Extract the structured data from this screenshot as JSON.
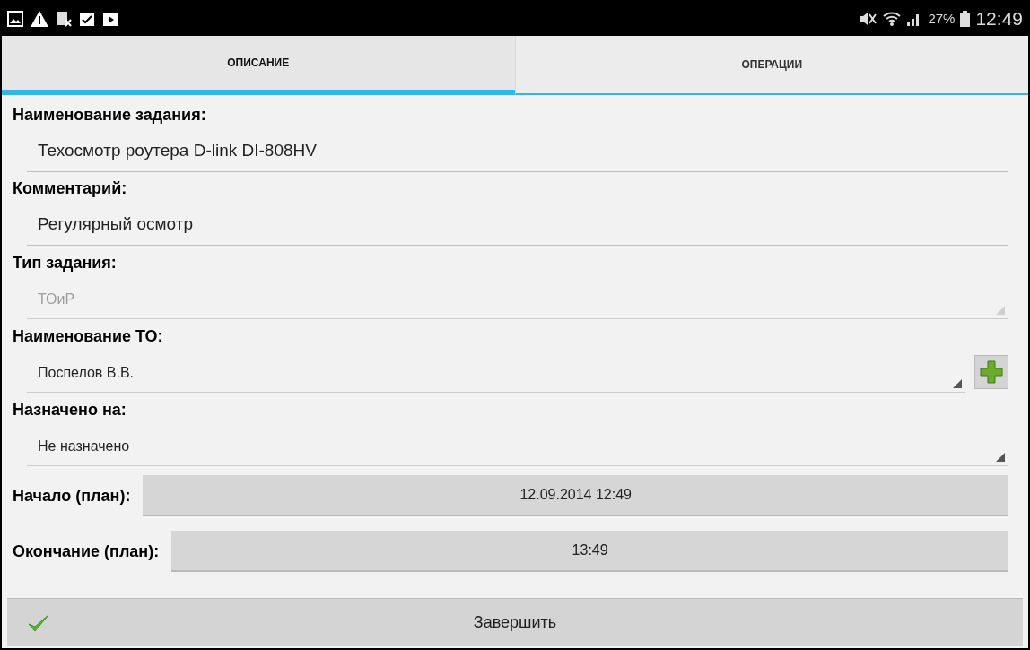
{
  "status_bar": {
    "battery": "27%",
    "time": "12:49"
  },
  "tabs": [
    {
      "label": "ОПИСАНИЕ",
      "selected": true
    },
    {
      "label": "ОПЕРАЦИИ",
      "selected": false
    }
  ],
  "fields": [
    {
      "kind": "text",
      "label": "Наименование задания:",
      "value": "Техосмотр роутера D-link DI-808HV"
    },
    {
      "kind": "text",
      "label": "Комментарий:",
      "value": "Регулярный осмотр"
    },
    {
      "kind": "select",
      "label": "Тип задания:",
      "value": "ТОиР",
      "disabled": true,
      "add_button": false
    },
    {
      "kind": "select",
      "label": "Наименование ТО:",
      "value": "Поспелов В.В.",
      "disabled": false,
      "add_button": true
    },
    {
      "kind": "select",
      "label": "Назначено на:",
      "value": "Не назначено",
      "disabled": false,
      "add_button": false
    },
    {
      "kind": "date",
      "label": "Начало (план):",
      "value": "12.09.2014 12:49"
    },
    {
      "kind": "date",
      "label": "Окончание (план):",
      "value": "13:49"
    }
  ],
  "finish_button": {
    "label": "Завершить"
  }
}
